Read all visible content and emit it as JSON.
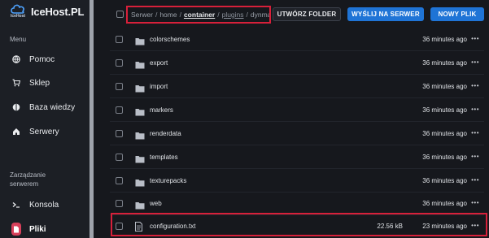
{
  "app": {
    "logo_text": "IceHost.PL",
    "logo_sub": "IceHost"
  },
  "sidebar": {
    "menu_heading": "Menu",
    "items": [
      {
        "label": "Pomoc",
        "icon": "globe-icon"
      },
      {
        "label": "Sklep",
        "icon": "cart-icon"
      },
      {
        "label": "Baza wiedzy",
        "icon": "book-icon"
      },
      {
        "label": "Serwery",
        "icon": "home-icon"
      }
    ],
    "manage_heading_line1": "Zarządzanie",
    "manage_heading_line2": "serwerem",
    "manage_items": [
      {
        "label": "Konsola",
        "icon": "terminal-icon"
      },
      {
        "label": "Pliki",
        "icon": "files-icon",
        "active": true
      }
    ]
  },
  "breadcrumb": {
    "root": "Serwer",
    "parts": [
      "home",
      "container",
      "plugins",
      "dynmap"
    ]
  },
  "toolbar": {
    "create_folder": "UTWÓRZ FOLDER",
    "upload": "WYŚLIJ NA SERWER",
    "new_file": "NOWY PLIK"
  },
  "files": [
    {
      "name": "colorschemes",
      "type": "folder",
      "size": "",
      "modified": "36 minutes ago"
    },
    {
      "name": "export",
      "type": "folder",
      "size": "",
      "modified": "36 minutes ago"
    },
    {
      "name": "import",
      "type": "folder",
      "size": "",
      "modified": "36 minutes ago"
    },
    {
      "name": "markers",
      "type": "folder",
      "size": "",
      "modified": "36 minutes ago"
    },
    {
      "name": "renderdata",
      "type": "folder",
      "size": "",
      "modified": "36 minutes ago"
    },
    {
      "name": "templates",
      "type": "folder",
      "size": "",
      "modified": "36 minutes ago"
    },
    {
      "name": "texturepacks",
      "type": "folder",
      "size": "",
      "modified": "36 minutes ago"
    },
    {
      "name": "web",
      "type": "folder",
      "size": "",
      "modified": "36 minutes ago"
    },
    {
      "name": "configuration.txt",
      "type": "file",
      "size": "22.56 kB",
      "modified": "23 minutes ago"
    }
  ],
  "colors": {
    "accent_blue": "#1f74d6",
    "highlight_red": "#d7203a",
    "active_pink": "#d8405b"
  }
}
